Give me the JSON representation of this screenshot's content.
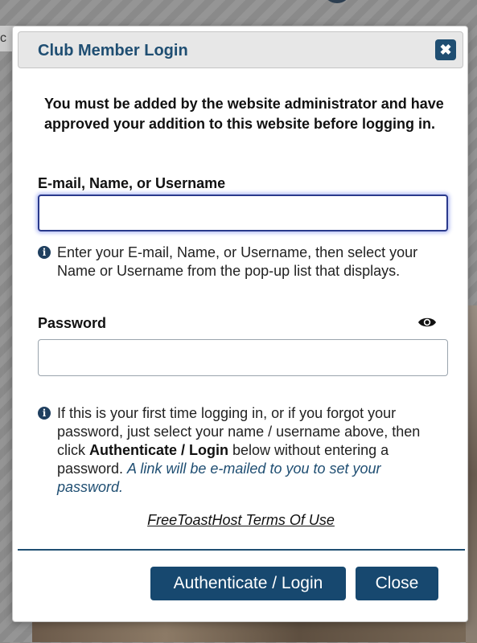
{
  "background": {
    "tab_fragment": "c"
  },
  "modal": {
    "title": "Club Member Login",
    "close_icon": "close-icon",
    "intro": "You must be added by the website administrator and have approved your addition to this website before logging in.",
    "username": {
      "label": "E-mail, Name, or Username",
      "value": "",
      "help": "Enter your E-mail, Name, or Username, then select your Name or Username from the pop-up list that displays."
    },
    "password": {
      "label": "Password",
      "value": "",
      "toggle_icon": "eye-icon",
      "help_part1": "If this is your first time logging in, or if you forgot your password, just select your name / username above, then click ",
      "help_emphasis": "Authenticate / Login",
      "help_part2": " below without entering a password. ",
      "help_italic": "A link will be e-mailed to you to set your password."
    },
    "info_icon_glyph": "i",
    "terms_link": "FreeToastHost Terms Of Use",
    "buttons": {
      "login": "Authenticate / Login",
      "close": "Close"
    }
  },
  "colors": {
    "accent": "#1f4e72",
    "button": "#17486f",
    "focus": "#2a3a8c"
  }
}
